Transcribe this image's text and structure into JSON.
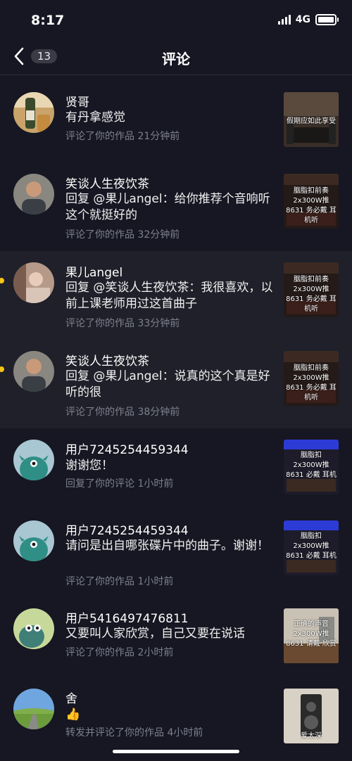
{
  "status": {
    "time": "8:17",
    "network": "4G"
  },
  "nav": {
    "badge": "13",
    "title": "评论"
  },
  "comments": [
    {
      "name": "贤哥",
      "content": "有丹拿感觉",
      "meta": "评论了你的作品  21分钟前",
      "thumb_text": "假期应如此享受",
      "unread": false,
      "highlight": false
    },
    {
      "name": "笑谈人生夜饮茶",
      "content": "回复 @果儿angel：给你推荐个音响听这个就挺好的",
      "meta": "评论了你的作品  32分钟前",
      "thumb_text": "胭脂扣前奏 2x300W推8631 务必戴 耳机听",
      "unread": false,
      "highlight": false
    },
    {
      "name": "果儿angel",
      "content": "回复 @笑谈人生夜饮茶：我很喜欢，以前上课老师用过这首曲子",
      "meta": "评论了你的作品  33分钟前",
      "thumb_text": "胭脂扣前奏 2x300W推8631 务必戴 耳机听",
      "unread": true,
      "highlight": true
    },
    {
      "name": "笑谈人生夜饮茶",
      "content": "回复 @果儿angel：说真的这个真是好听的很",
      "meta": "评论了你的作品  38分钟前",
      "thumb_text": "胭脂扣前奏 2x300W推8631 务必戴 耳机听",
      "unread": true,
      "highlight": true
    },
    {
      "name": "用户7245254459344",
      "content": "谢谢您！",
      "meta": "回复了你的评论  1小时前",
      "thumb_text": "胭脂扣 2x300W推8631 必戴 耳机",
      "unread": false,
      "highlight": false
    },
    {
      "name": "用户7245254459344",
      "content": "请问是出自哪张碟片中的曲子。谢谢！",
      "meta": "评论了你的作品  1小时前",
      "thumb_text": "胭脂扣 2x300W推8631 必戴 耳机",
      "unread": false,
      "highlight": false
    },
    {
      "name": "用户5416497476811",
      "content": "又要叫人家欣赏，自己又要在说话",
      "meta": "评论了你的作品  2小时前",
      "thumb_text": "正确的声音 2x300W推8631 请戴 欣赏",
      "unread": false,
      "highlight": false
    },
    {
      "name": "舍",
      "content": "👍",
      "meta": "转发并评论了你的作品  4小时前",
      "thumb_text": "爱太深",
      "unread": false,
      "highlight": false
    }
  ],
  "colors": {
    "background": "#161722",
    "accent_dot": "#f5c518",
    "meta_text": "#7f8090"
  }
}
